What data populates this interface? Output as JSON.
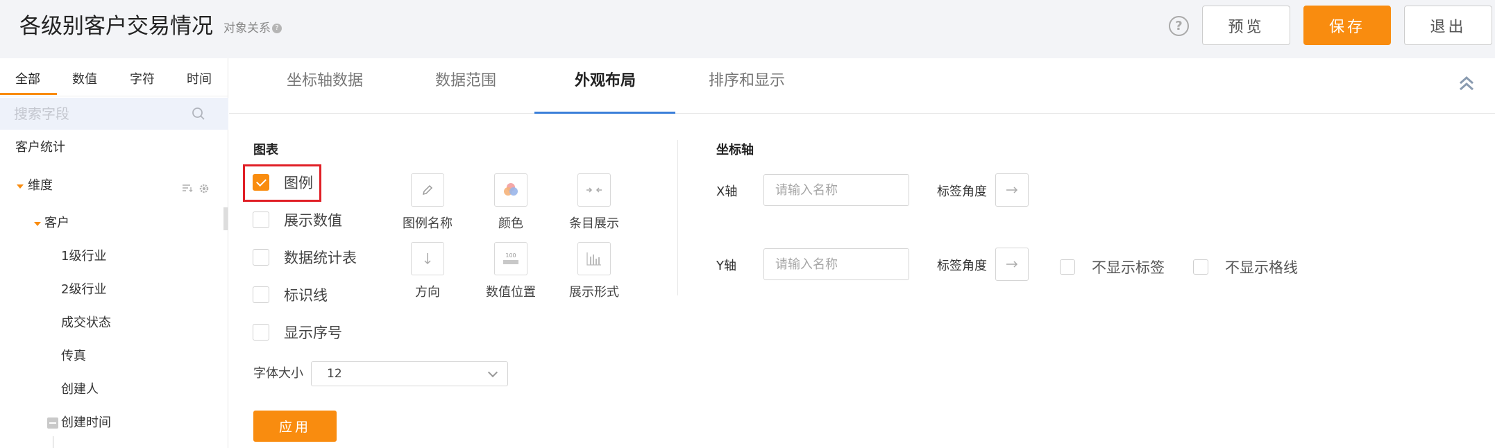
{
  "header": {
    "title": "各级别客户交易情况",
    "object_relation": "对象关系",
    "help_icon": "?",
    "preview_label": "预览",
    "save_label": "保存",
    "exit_label": "退出"
  },
  "sidebar": {
    "tabs": [
      {
        "label": "全部",
        "active": true
      },
      {
        "label": "数值"
      },
      {
        "label": "字符"
      },
      {
        "label": "时间"
      }
    ],
    "search_placeholder": "搜索字段",
    "tree": {
      "root": "客户统计",
      "dimension": "维度",
      "customer": "客户",
      "fields": [
        "1级行业",
        "2级行业",
        "成交状态",
        "传真",
        "创建人"
      ],
      "created_time": "创建时间"
    }
  },
  "main": {
    "tabs": [
      {
        "label": "坐标轴数据"
      },
      {
        "label": "数据范围"
      },
      {
        "label": "外观布局",
        "active": true
      },
      {
        "label": "排序和显示"
      }
    ],
    "chart_section": {
      "title": "图表",
      "options": [
        {
          "label": "图例",
          "checked": true
        },
        {
          "label": "展示数值",
          "checked": false
        },
        {
          "label": "数据统计表",
          "checked": false
        },
        {
          "label": "标识线",
          "checked": false
        },
        {
          "label": "显示序号",
          "checked": false
        }
      ],
      "tools": [
        {
          "label": "图例名称",
          "icon": "pencil-icon"
        },
        {
          "label": "颜色",
          "icon": "color-circles-icon"
        },
        {
          "label": "条目展示",
          "icon": "arrows-in-icon"
        },
        {
          "label": "方向",
          "icon": "arrow-down-icon"
        },
        {
          "label": "数值位置",
          "icon": "value-position-icon"
        },
        {
          "label": "展示形式",
          "icon": "bar-chart-icon"
        }
      ],
      "font_size_label": "字体大小",
      "font_size_value": "12",
      "apply_label": "应用"
    },
    "axis_section": {
      "title": "坐标轴",
      "x_label": "X轴",
      "y_label": "Y轴",
      "name_placeholder": "请输入名称",
      "angle_label": "标签角度",
      "hide_labels": "不显示标签",
      "hide_gridlines": "不显示格线"
    }
  },
  "colors": {
    "accent": "#f98c0f",
    "tab_underline": "#3b7fd9",
    "highlight": "#e01f26"
  }
}
